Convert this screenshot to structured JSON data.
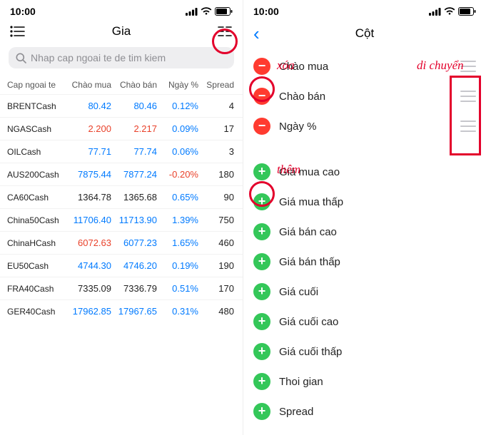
{
  "status": {
    "time": "10:00"
  },
  "left": {
    "title": "Gia",
    "search_placeholder": "Nhap cap ngoai te de tim kiem",
    "headers": {
      "sym": "Cap ngoai te",
      "bid": "Chào mua",
      "ask": "Chào bán",
      "day": "Ngày %",
      "spread": "Spread"
    },
    "rows": [
      {
        "sym": "BRENTCash",
        "bid": "80.42",
        "bid_cls": "blue",
        "ask": "80.46",
        "ask_cls": "blue",
        "day": "0.12%",
        "day_cls": "blue",
        "spread": "4"
      },
      {
        "sym": "NGASCash",
        "bid": "2.200",
        "bid_cls": "red",
        "ask": "2.217",
        "ask_cls": "red",
        "day": "0.09%",
        "day_cls": "blue",
        "spread": "17"
      },
      {
        "sym": "OILCash",
        "bid": "77.71",
        "bid_cls": "blue",
        "ask": "77.74",
        "ask_cls": "blue",
        "day": "0.06%",
        "day_cls": "blue",
        "spread": "3"
      },
      {
        "sym": "AUS200Cash",
        "bid": "7875.44",
        "bid_cls": "blue",
        "ask": "7877.24",
        "ask_cls": "blue",
        "day": "-0.20%",
        "day_cls": "red",
        "spread": "180"
      },
      {
        "sym": "CA60Cash",
        "bid": "1364.78",
        "bid_cls": "black",
        "ask": "1365.68",
        "ask_cls": "black",
        "day": "0.65%",
        "day_cls": "blue",
        "spread": "90"
      },
      {
        "sym": "China50Cash",
        "bid": "11706.40",
        "bid_cls": "blue",
        "ask": "11713.90",
        "ask_cls": "blue",
        "day": "1.39%",
        "day_cls": "blue",
        "spread": "750"
      },
      {
        "sym": "ChinaHCash",
        "bid": "6072.63",
        "bid_cls": "red",
        "ask": "6077.23",
        "ask_cls": "blue",
        "day": "1.65%",
        "day_cls": "blue",
        "spread": "460"
      },
      {
        "sym": "EU50Cash",
        "bid": "4744.30",
        "bid_cls": "blue",
        "ask": "4746.20",
        "ask_cls": "blue",
        "day": "0.19%",
        "day_cls": "blue",
        "spread": "190"
      },
      {
        "sym": "FRA40Cash",
        "bid": "7335.09",
        "bid_cls": "black",
        "ask": "7336.79",
        "ask_cls": "black",
        "day": "0.51%",
        "day_cls": "blue",
        "spread": "170"
      },
      {
        "sym": "GER40Cash",
        "bid": "17962.85",
        "bid_cls": "blue",
        "ask": "17967.65",
        "ask_cls": "blue",
        "day": "0.31%",
        "day_cls": "blue",
        "spread": "480"
      }
    ]
  },
  "right": {
    "title": "Cột",
    "active": [
      {
        "label": "Chào mua"
      },
      {
        "label": "Chào bán"
      },
      {
        "label": "Ngày %"
      }
    ],
    "available": [
      {
        "label": "Giá mua cao"
      },
      {
        "label": "Giá mua thấp"
      },
      {
        "label": "Giá bán cao"
      },
      {
        "label": "Giá bán thấp"
      },
      {
        "label": "Giá cuối"
      },
      {
        "label": "Giá cuối cao"
      },
      {
        "label": "Giá cuối thấp"
      },
      {
        "label": "Thoi gian"
      },
      {
        "label": "Spread"
      }
    ]
  },
  "annotations": {
    "delete": "xóa",
    "add": "thêm",
    "move": "di chuyển"
  }
}
